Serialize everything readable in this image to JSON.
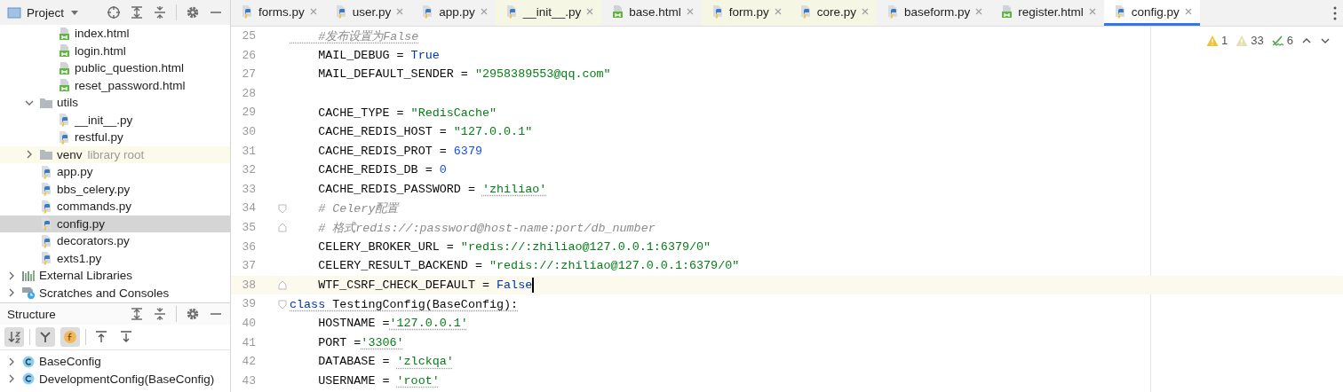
{
  "project_panel": {
    "title": "Project",
    "tree": [
      {
        "children": [
          {
            "children": [
              {
                "kind": "html",
                "label": "index.html"
              },
              {
                "kind": "html",
                "label": "login.html"
              },
              {
                "kind": "html",
                "label": "public_question.html"
              },
              {
                "kind": "html",
                "label": "reset_password.html"
              }
            ]
          },
          {
            "kind": "folder",
            "label": "utils",
            "expanded": true,
            "children": [
              {
                "kind": "python",
                "label": "__init__.py"
              },
              {
                "kind": "python",
                "label": "restful.py"
              }
            ]
          },
          {
            "kind": "folder",
            "label": "venv",
            "hint": "library root",
            "expanded": false
          },
          {
            "kind": "python",
            "label": "app.py"
          },
          {
            "kind": "python",
            "label": "bbs_celery.py"
          },
          {
            "kind": "python",
            "label": "commands.py"
          },
          {
            "kind": "python",
            "label": "config.py",
            "selected": true
          },
          {
            "kind": "python",
            "label": "decorators.py"
          },
          {
            "kind": "python",
            "label": "exts1.py"
          }
        ]
      },
      {
        "kind": "libraries",
        "label": "External Libraries",
        "expanded": false
      },
      {
        "kind": "scratches",
        "label": "Scratches and Consoles",
        "expanded": false
      }
    ]
  },
  "structure_panel": {
    "title": "Structure",
    "toolbar": [
      {
        "kind": "sort",
        "on": true
      },
      {
        "kind": "inherited",
        "on": true
      },
      {
        "kind": "fields",
        "on": true
      },
      {
        "kind": "expand",
        "on": false
      },
      {
        "kind": "collapse",
        "on": false
      }
    ],
    "items": [
      {
        "kind": "class",
        "label": "BaseConfig",
        "expanded": false
      },
      {
        "kind": "class",
        "label": "DevelopmentConfig(BaseConfig)",
        "expanded": false
      }
    ]
  },
  "tabs": [
    {
      "kind": "python",
      "label": "forms.py",
      "selected": false,
      "highlighted": false
    },
    {
      "kind": "python",
      "label": "user.py",
      "selected": false,
      "highlighted": false
    },
    {
      "kind": "python",
      "label": "app.py",
      "selected": false,
      "highlighted": false
    },
    {
      "kind": "python",
      "label": "__init__.py",
      "selected": false,
      "highlighted": true
    },
    {
      "kind": "html",
      "label": "base.html",
      "selected": false,
      "highlighted": false
    },
    {
      "kind": "python",
      "label": "form.py",
      "selected": false,
      "highlighted": true
    },
    {
      "kind": "python",
      "label": "core.py",
      "selected": false,
      "highlighted": true
    },
    {
      "kind": "python",
      "label": "baseform.py",
      "selected": false,
      "highlighted": false
    },
    {
      "kind": "html",
      "label": "register.html",
      "selected": false,
      "highlighted": false
    },
    {
      "kind": "python",
      "label": "config.py",
      "selected": true,
      "highlighted": false
    }
  ],
  "inspections": [
    {
      "kind": "warning",
      "count": "1"
    },
    {
      "kind": "weak-warning",
      "count": "33"
    },
    {
      "kind": "typo",
      "count": "6"
    }
  ],
  "code_lines": [
    {
      "number": "25",
      "fold_start": false,
      "fold_end": false,
      "tokens": [
        {
          "kind": "comment",
          "text": "    #发布设置为False",
          "typo": true
        }
      ]
    },
    {
      "number": "26",
      "fold_start": false,
      "fold_end": false,
      "tokens": [
        {
          "kind": "plain",
          "text": "    MAIL_DEBUG = "
        },
        {
          "kind": "keyword",
          "text": "True"
        }
      ]
    },
    {
      "number": "27",
      "fold_start": false,
      "fold_end": false,
      "tokens": [
        {
          "kind": "plain",
          "text": "    MAIL_DEFAULT_SENDER = "
        },
        {
          "kind": "string",
          "text": "\"2958389553@qq.com\""
        }
      ]
    },
    {
      "number": "28",
      "fold_start": false,
      "fold_end": false
    },
    {
      "number": "29",
      "fold_start": false,
      "fold_end": false,
      "tokens": [
        {
          "kind": "plain",
          "text": "    CACHE_TYPE = "
        },
        {
          "kind": "string",
          "text": "\"RedisCache\""
        }
      ]
    },
    {
      "number": "30",
      "fold_start": false,
      "fold_end": false,
      "tokens": [
        {
          "kind": "plain",
          "text": "    CACHE_REDIS_HOST = "
        },
        {
          "kind": "string",
          "text": "\"127.0.0.1\""
        }
      ]
    },
    {
      "number": "31",
      "fold_start": false,
      "fold_end": false,
      "tokens": [
        {
          "kind": "plain",
          "text": "    CACHE_REDIS_PROT = "
        },
        {
          "kind": "number",
          "text": "6379"
        }
      ]
    },
    {
      "number": "32",
      "fold_start": false,
      "fold_end": false,
      "tokens": [
        {
          "kind": "plain",
          "text": "    CACHE_REDIS_DB = "
        },
        {
          "kind": "number",
          "text": "0"
        }
      ]
    },
    {
      "number": "33",
      "fold_start": false,
      "fold_end": false,
      "tokens": [
        {
          "kind": "plain",
          "text": "    CACHE_REDIS_PASSWORD = "
        },
        {
          "kind": "string",
          "text": "'zhiliao'",
          "typo": true
        }
      ]
    },
    {
      "number": "34",
      "fold_start": true,
      "fold_end": false,
      "tokens": [
        {
          "kind": "comment",
          "text": "    # Celery配置"
        }
      ]
    },
    {
      "number": "35",
      "fold_start": false,
      "fold_end": true,
      "tokens": [
        {
          "kind": "comment",
          "text": "    # 格式redis://:password@host-name:port/db_number"
        }
      ]
    },
    {
      "number": "36",
      "fold_start": false,
      "fold_end": false,
      "tokens": [
        {
          "kind": "plain",
          "text": "    CELERY_BROKER_URL = "
        },
        {
          "kind": "string",
          "text": "\"redis://:zhiliao@127.0.0.1:6379/0\""
        }
      ]
    },
    {
      "number": "37",
      "fold_start": false,
      "fold_end": false,
      "tokens": [
        {
          "kind": "plain",
          "text": "    CELERY_RESULT_BACKEND = "
        },
        {
          "kind": "string",
          "text": "\"redis://:zhiliao@127.0.0.1:6379/0\""
        }
      ]
    },
    {
      "number": "38",
      "fold_start": false,
      "fold_end": true,
      "current": true,
      "tokens": [
        {
          "kind": "plain",
          "text": "    WTF_CSRF_CHECK_DEFAULT = "
        },
        {
          "kind": "keyword",
          "text": "False"
        }
      ]
    },
    {
      "number": "39",
      "fold_start": true,
      "fold_end": false,
      "tokens": [
        {
          "kind": "keyword",
          "text": "class",
          "typo": true
        },
        {
          "kind": "plain",
          "text": " TestingConfig(BaseConfig):",
          "typo": true
        }
      ]
    },
    {
      "number": "40",
      "fold_start": false,
      "fold_end": false,
      "tokens": [
        {
          "kind": "plain",
          "text": "    HOSTNAME ="
        },
        {
          "kind": "string",
          "text": "'127.0.0.1'",
          "typo": true
        }
      ]
    },
    {
      "number": "41",
      "fold_start": false,
      "fold_end": false,
      "tokens": [
        {
          "kind": "plain",
          "text": "    PORT ="
        },
        {
          "kind": "string",
          "text": "'3306'",
          "typo": true
        }
      ]
    },
    {
      "number": "42",
      "fold_start": false,
      "fold_end": false,
      "tokens": [
        {
          "kind": "plain",
          "text": "    DATABASE = "
        },
        {
          "kind": "string",
          "text": "'zlckqa'",
          "typo": true
        }
      ]
    },
    {
      "number": "43",
      "fold_start": false,
      "fold_end": false,
      "tokens": [
        {
          "kind": "plain",
          "text": "    USERNAME = "
        },
        {
          "kind": "string",
          "text": "'root'",
          "typo": true
        }
      ]
    }
  ]
}
